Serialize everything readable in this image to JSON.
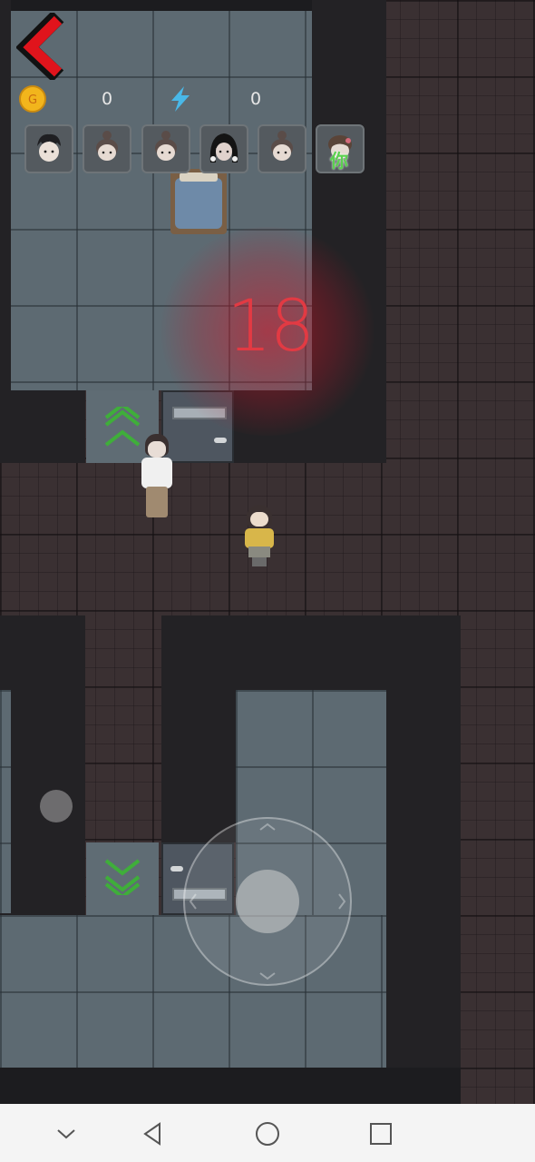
{
  "hud": {
    "coins": "0",
    "energy": "0",
    "timer": "18",
    "icons": {
      "back": "back-arrow-icon",
      "coin": "gold-coin-icon",
      "energy": "lightning-bolt-icon"
    },
    "colors": {
      "back_arrow": "#e0141c",
      "timer": "#e23a43",
      "coin": "#f2b51c",
      "energy": "#49b8e8",
      "stairs_arrow": "#3fae3a"
    }
  },
  "players": [
    {
      "id": "player-1",
      "icon": "messy-hair-avatar-icon"
    },
    {
      "id": "player-2",
      "icon": "bun-girl-avatar-icon"
    },
    {
      "id": "player-3",
      "icon": "bun-girl-avatar-icon"
    },
    {
      "id": "player-4",
      "icon": "long-black-hair-girl-avatar-icon"
    },
    {
      "id": "player-5",
      "icon": "bun-girl-avatar-icon"
    },
    {
      "id": "player-6",
      "icon": "self-avatar-icon",
      "tag": "你"
    }
  ],
  "map": {
    "objects": [
      "bed",
      "door-top",
      "door-bottom",
      "stairs-up",
      "stairs-down"
    ],
    "characters": [
      "ghost-girl-white-shirt",
      "player-girl-yellow"
    ]
  },
  "controls": {
    "joystick": "virtual-joystick",
    "action_dot": "side-action-dot"
  },
  "system_nav": {
    "icons": [
      "nav-collapse-icon",
      "nav-back-icon",
      "nav-home-icon",
      "nav-recents-icon"
    ]
  }
}
